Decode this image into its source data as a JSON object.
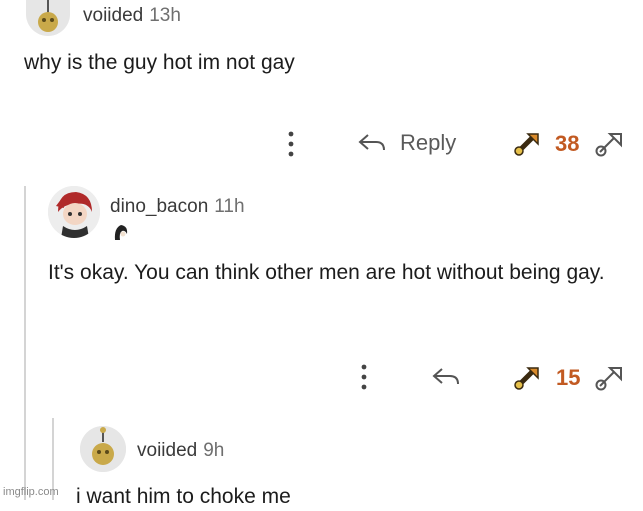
{
  "comments": [
    {
      "username": "voiided",
      "time": "13h",
      "text": "why is the guy hot im not gay",
      "reply_label": "Reply",
      "vote_count": "38"
    },
    {
      "username": "dino_bacon",
      "time": "11h",
      "text": "It's okay. You can think other men are hot without being gay.",
      "vote_count": "15"
    },
    {
      "username": "voiided",
      "time": "9h",
      "text": "i want him to choke me"
    }
  ],
  "icons": {
    "more": "vertical-dots-icon",
    "reply": "reply-arrow-icon",
    "upvote": "upvote-icon",
    "downvote": "downvote-icon"
  },
  "colors": {
    "vote_count": "#c25a22",
    "text": "#1c1c1c",
    "muted": "#6f6f6f"
  },
  "watermark": "imgflip.com"
}
